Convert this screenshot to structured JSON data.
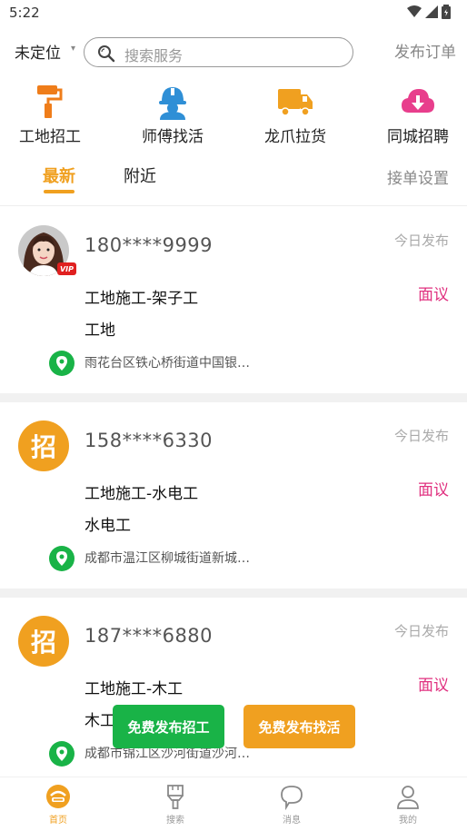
{
  "status_bar": {
    "time": "5:22"
  },
  "top_bar": {
    "location": "未定位",
    "search_placeholder": "搜索服务",
    "publish_order": "发布订单"
  },
  "categories": [
    {
      "label": "工地招工",
      "icon": "paint-roller-icon",
      "color": "#ef7d1a"
    },
    {
      "label": "师傅找活",
      "icon": "worker-helmet-icon",
      "color": "#2f8fd6"
    },
    {
      "label": "龙爪拉货",
      "icon": "truck-icon",
      "color": "#f0a020"
    },
    {
      "label": "同城招聘",
      "icon": "cloud-download-icon",
      "color": "#e83e8c"
    }
  ],
  "tabs": {
    "latest": "最新",
    "nearby": "附近",
    "settings": "接单设置"
  },
  "listings": [
    {
      "avatar": "photo",
      "vip": "VIP",
      "phone": "180****9999",
      "posted": "今日发布",
      "title": "工地施工-架子工",
      "salary": "面议",
      "type": "工地",
      "address": "雨花台区铁心桥街道中国银…"
    },
    {
      "avatar": "招",
      "phone": "158****6330",
      "posted": "今日发布",
      "title": "工地施工-水电工",
      "salary": "面议",
      "type": "水电工",
      "address": "成都市温江区柳城街道新城…"
    },
    {
      "avatar": "招",
      "phone": "187****6880",
      "posted": "今日发布",
      "title": "工地施工-木工",
      "salary": "面议",
      "type": "木工",
      "address": "成都市锦江区沙河街道沙河…"
    }
  ],
  "float_buttons": {
    "recruit": "免费发布招工",
    "find_work": "免费发布找活"
  },
  "bottom_nav": [
    {
      "label": "首页",
      "icon": "home-icon",
      "active": true
    },
    {
      "label": "搜索",
      "icon": "brush-icon",
      "active": false
    },
    {
      "label": "消息",
      "icon": "chat-bubble-icon",
      "active": false
    },
    {
      "label": "我的",
      "icon": "person-icon",
      "active": false
    }
  ],
  "colors": {
    "accent": "#f0a020",
    "salary": "#e0307f",
    "location_pin": "#19b347",
    "recruit_button": "#19b347"
  }
}
